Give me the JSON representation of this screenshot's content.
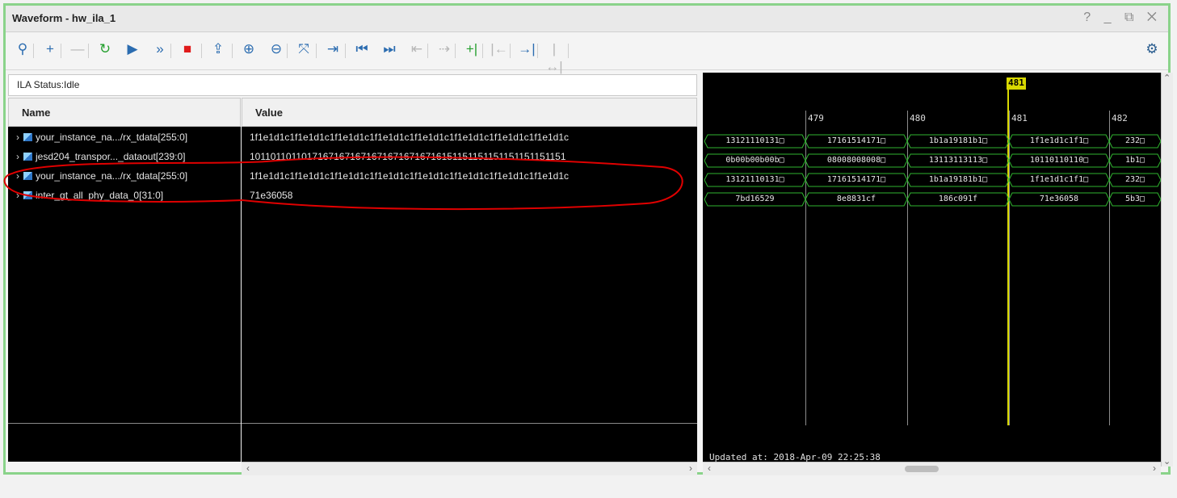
{
  "window": {
    "title": "Waveform - hw_ila_1",
    "controls": "? _ ⧉ ✕"
  },
  "toolbar": {
    "buttons": [
      {
        "name": "search-icon",
        "glyph": "⚲"
      },
      {
        "name": "add-icon",
        "glyph": "+"
      },
      {
        "name": "remove-icon",
        "glyph": "—"
      },
      {
        "name": "run-trigger-immediate-icon",
        "glyph": "↻"
      },
      {
        "name": "run-trigger-icon",
        "glyph": "▶"
      },
      {
        "name": "auto-retrigger-icon",
        "glyph": "»"
      },
      {
        "name": "stop-trigger-icon",
        "glyph": "■"
      },
      {
        "name": "export-icon",
        "glyph": "⇪"
      },
      {
        "name": "zoom-in-icon",
        "glyph": "⊕"
      },
      {
        "name": "zoom-out-icon",
        "glyph": "⊖"
      },
      {
        "name": "zoom-fit-icon",
        "glyph": "⤧"
      },
      {
        "name": "go-to-cursor-icon",
        "glyph": "⇥"
      },
      {
        "name": "go-to-start-icon",
        "glyph": "⏮"
      },
      {
        "name": "go-to-end-icon",
        "glyph": "⏭"
      },
      {
        "name": "previous-transition-icon",
        "glyph": "⇤"
      },
      {
        "name": "next-transition-icon",
        "glyph": "⇢"
      },
      {
        "name": "add-marker-icon",
        "glyph": "+|"
      },
      {
        "name": "previous-marker-icon",
        "glyph": "|←"
      },
      {
        "name": "next-marker-icon",
        "glyph": "→|"
      },
      {
        "name": "swap-cursors-icon",
        "glyph": "|↔|"
      }
    ],
    "settings_glyph": "⚙"
  },
  "status": {
    "text": "ILA Status:Idle"
  },
  "columns": {
    "name": "Name",
    "value": "Value"
  },
  "signals": [
    {
      "name": "your_instance_na.../rx_tdata[255:0]",
      "value": "1f1e1d1c1f1e1d1c1f1e1d1c1f1e1d1c1f1e1d1c1f1e1d1c1f1e1d1c1f1e1d1c"
    },
    {
      "name": "jesd204_transpor..._dataout[239:0]",
      "value": "101101101101716716716716716716716716151151151151151151151151"
    },
    {
      "name": "your_instance_na.../rx_tdata[255:0]",
      "value": "1f1e1d1c1f1e1d1c1f1e1d1c1f1e1d1c1f1e1d1c1f1e1d1c1f1e1d1c1f1e1d1c"
    },
    {
      "name": "inter_gt_all_phy_data_0[31:0]",
      "value": "71e36058"
    }
  ],
  "wave": {
    "cursor_label": "481",
    "ticks": [
      "479",
      "480",
      "481",
      "482"
    ],
    "rows": [
      [
        "13121110131□",
        "17161514171□",
        "1b1a19181b1□",
        "1f1e1d1c1f1□",
        "232□"
      ],
      [
        "0b00b00b00b□",
        "08008008008□",
        "13113113113□",
        "10110110110□",
        "1b1□"
      ],
      [
        "13121110131□",
        "17161514171□",
        "1b1a19181b1□",
        "1f1e1d1c1f1□",
        "232□"
      ],
      [
        "7bd16529",
        "8e8831cf",
        "186c091f",
        "71e36058",
        "5b3□"
      ]
    ],
    "updated": "Updated at: 2018-Apr-09 22:25:38"
  },
  "colors": {
    "window_border": "#8ad38a",
    "wave_green": "#2fb52f",
    "cursor": "#d8d800",
    "annotation": "#e00000"
  }
}
